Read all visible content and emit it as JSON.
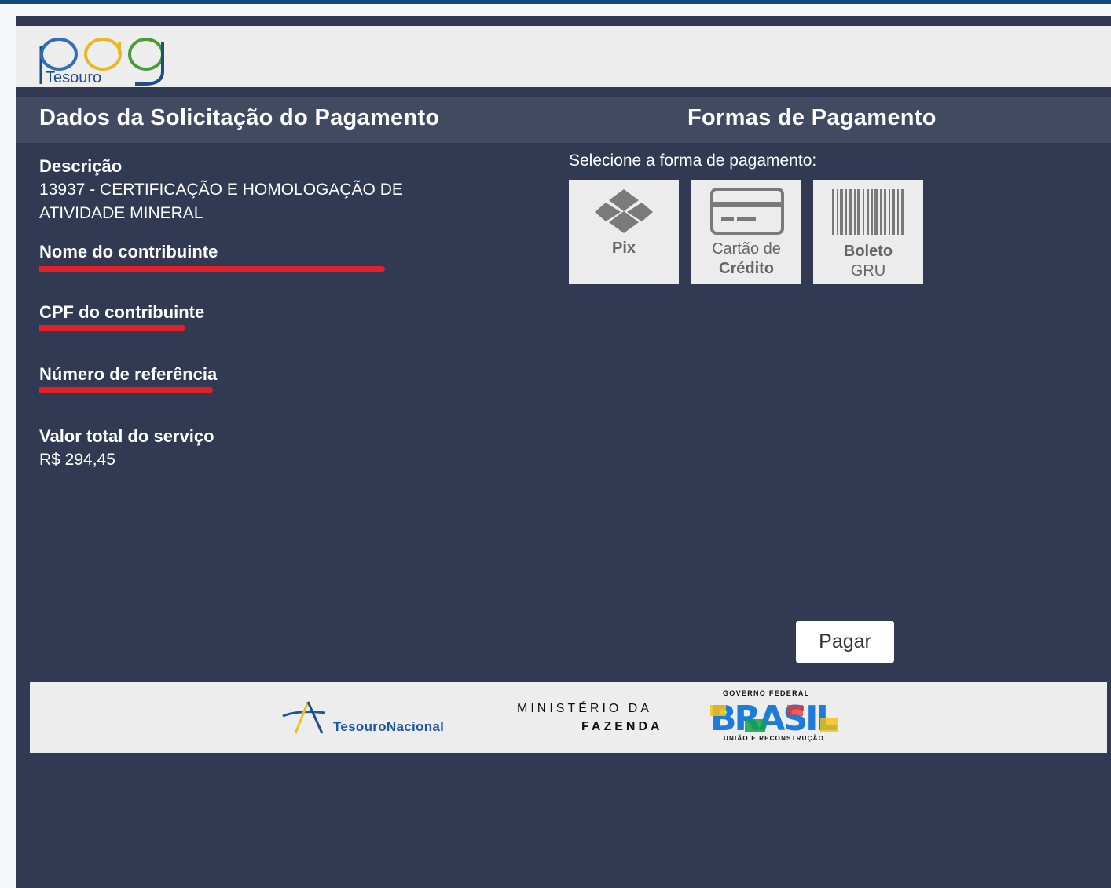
{
  "header": {
    "logo_word": "pag",
    "logo_sub": "Tesouro"
  },
  "sections": {
    "left_title": "Dados da Solicitação do Pagamento",
    "right_title": "Formas de Pagamento"
  },
  "details": {
    "descricao_label": "Descrição",
    "descricao_line1": "13937 - CERTIFICAÇÃO E HOMOLOGAÇÃO DE",
    "descricao_line2": "ATIVIDADE MINERAL",
    "nome_label": "Nome do contribuinte",
    "cpf_label": "CPF do contribuinte",
    "ref_label": "Número de referência",
    "valor_label": "Valor total do serviço",
    "valor": "R$  294,45"
  },
  "payment": {
    "prompt": "Selecione a forma de pagamento:",
    "options": [
      {
        "line1": "Pix",
        "icon": "pix-icon"
      },
      {
        "line1": "Cartão de",
        "line2": "Crédito",
        "icon": "credit-card-icon"
      },
      {
        "line1": "Boleto",
        "line2": "GRU",
        "icon": "barcode-icon"
      }
    ],
    "pay_button": "Pagar"
  },
  "footer": {
    "tesouro_text": "TesouroNacional",
    "ministerio_line1": "MINISTÉRIO DA",
    "ministerio_line2": "FAZENDA",
    "gov_line": "GOVERNO FEDERAL",
    "brasil_word": "BRASIL",
    "gov_tagline": "UNIÃO E RECONSTRUÇÃO"
  },
  "colors": {
    "background": "#313a52",
    "band": "#414a61",
    "redaction": "#e2202a",
    "header_bg": "#ededee"
  }
}
